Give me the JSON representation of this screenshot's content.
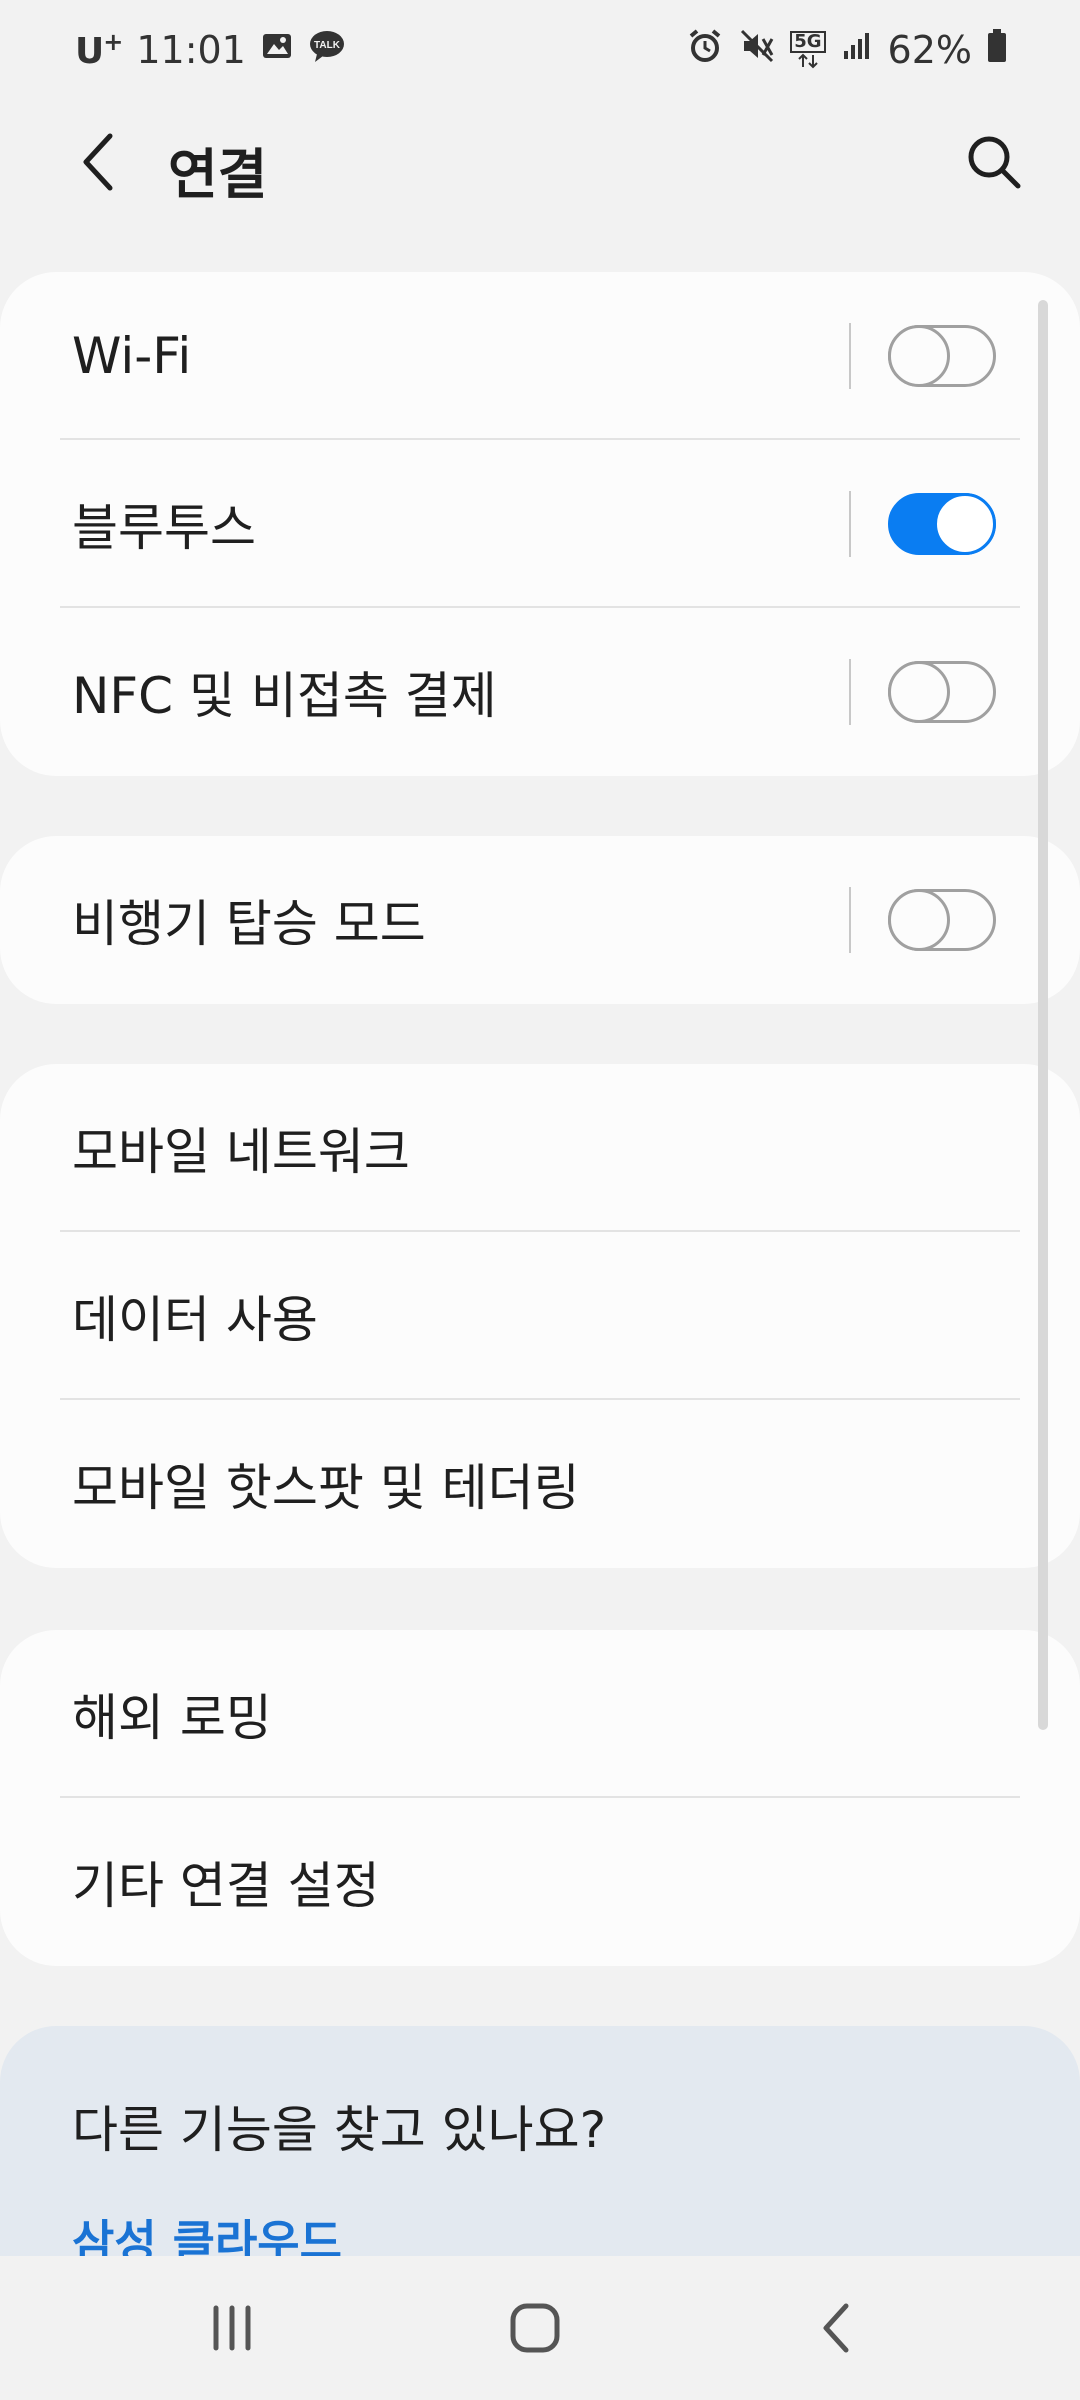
{
  "status_bar": {
    "carrier": "U",
    "carrier_sup": "+",
    "time": "11:01",
    "network": "5G",
    "battery": "62%"
  },
  "header": {
    "title": "연결"
  },
  "groups": [
    {
      "items": [
        {
          "label": "Wi-Fi",
          "toggle": false
        },
        {
          "label": "블루투스",
          "toggle": true
        },
        {
          "label": "NFC 및 비접촉 결제",
          "toggle": false
        }
      ]
    },
    {
      "items": [
        {
          "label": "비행기 탑승 모드",
          "toggle": false
        }
      ]
    },
    {
      "items": [
        {
          "label": "모바일 네트워크"
        },
        {
          "label": "데이터 사용"
        },
        {
          "label": "모바일 핫스팟 및 테더링"
        }
      ]
    },
    {
      "items": [
        {
          "label": "해외 로밍"
        },
        {
          "label": "기타 연결 설정"
        }
      ]
    }
  ],
  "suggestion": {
    "title": "다른 기능을 찾고 있나요?",
    "link": "삼성 클라우드"
  },
  "colors": {
    "accent": "#0a7df2",
    "link": "#1a73d4",
    "background": "#f2f2f2",
    "card": "#fcfcfc"
  }
}
